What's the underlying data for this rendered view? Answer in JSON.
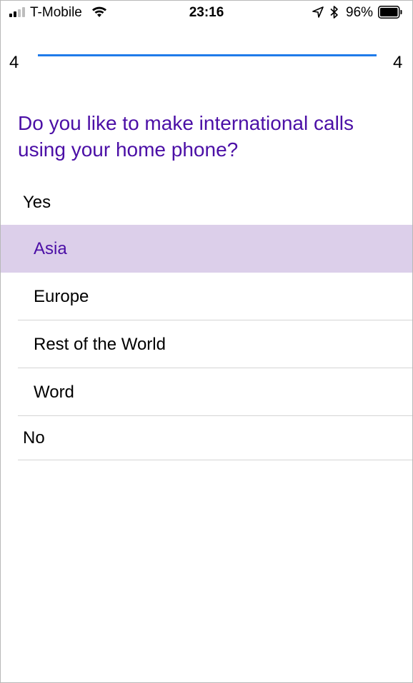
{
  "status_bar": {
    "carrier": "T-Mobile",
    "time": "23:16",
    "battery_percent": "96%",
    "icons": [
      "signal-icon",
      "wifi-icon",
      "location-icon",
      "bluetooth-icon",
      "battery-icon"
    ],
    "signal_bars_filled": 2,
    "signal_bars_total": 4,
    "battery_level": 0.96
  },
  "progress": {
    "current": "4",
    "total": "4",
    "fraction": 1.0,
    "fill_color": "#1f7bea"
  },
  "question": {
    "text": "Do you like to make international calls using your home phone?",
    "color": "#4b0fa6"
  },
  "options": [
    {
      "label": "Yes",
      "level": "top",
      "selected": false
    },
    {
      "label": "Asia",
      "level": "sub",
      "selected": true
    },
    {
      "label": "Europe",
      "level": "sub",
      "selected": false
    },
    {
      "label": "Rest of the World",
      "level": "sub",
      "selected": false
    },
    {
      "label": "Word",
      "level": "sub",
      "selected": false
    },
    {
      "label": "No",
      "level": "top",
      "selected": false
    }
  ],
  "colors": {
    "accent": "#4b0fa6",
    "selected_background": "#dccfea"
  }
}
